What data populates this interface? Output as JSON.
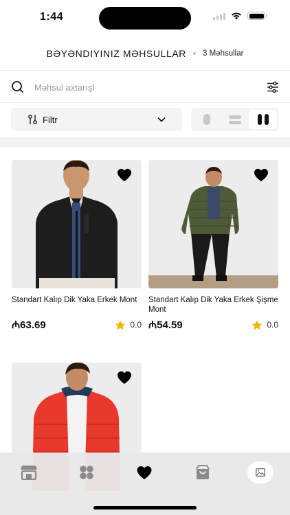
{
  "status": {
    "time": "1:44"
  },
  "header": {
    "title": "BƏYƏNDIYINIZ MƏHSULLAR",
    "count": "3 Məhsullar"
  },
  "search": {
    "placeholder": "Məhsul axtarışl"
  },
  "toolbar": {
    "filter_label": "Filtr",
    "view_modes": [
      "single",
      "list",
      "grid"
    ],
    "active_view": "grid"
  },
  "products": [
    {
      "title": "Standart Kalıp Dik Yaka Erkek Mont",
      "price": "₼63.69",
      "rating": "0.0",
      "favorite": true
    },
    {
      "title": "Standart Kalıp Dik Yaka Erkek Şişme Mont",
      "price": "₼54.59",
      "rating": "0.0",
      "favorite": true
    },
    {
      "title": "",
      "price": "",
      "rating": "",
      "favorite": true
    }
  ],
  "tabbar": {
    "items": [
      "store-icon",
      "categories-icon",
      "heart-icon",
      "bag-icon",
      "image-icon"
    ],
    "active": "image-icon"
  },
  "colors": {
    "star": "#f5b400",
    "accent": "#000000",
    "background": "#ffffff"
  }
}
